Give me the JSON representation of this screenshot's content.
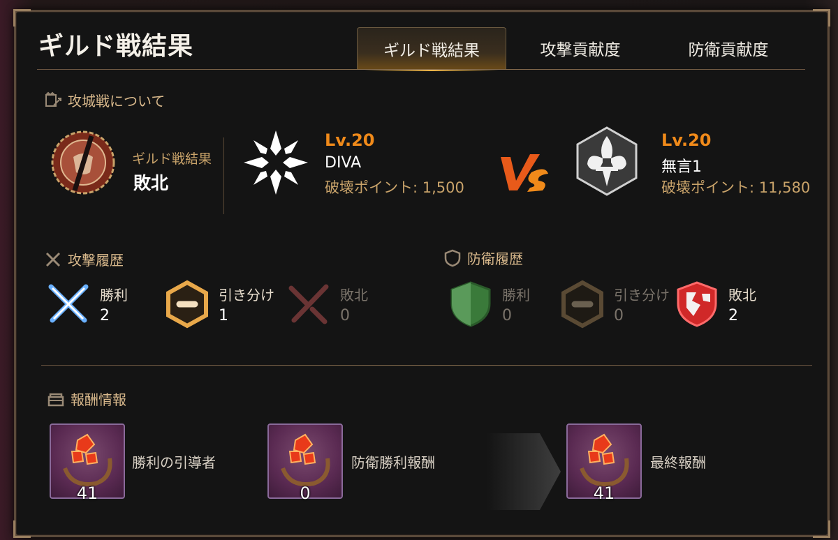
{
  "title": "ギルド戦結果",
  "tabs": [
    {
      "label": "ギルド戦結果",
      "active": true
    },
    {
      "label": "攻撃貢献度",
      "active": false
    },
    {
      "label": "防衛貢献度",
      "active": false
    }
  ],
  "siege": {
    "heading": "攻城戦について",
    "result_label": "ギルド戦結果",
    "result_value": "敗北"
  },
  "guild_left": {
    "level": "Lv.20",
    "name": "DIVA",
    "points": "破壊ポイント: 1,500"
  },
  "guild_right": {
    "level": "Lv.20",
    "name": "無言1",
    "points": "破壊ポイント: 11,580"
  },
  "attack": {
    "heading": "攻撃履歴",
    "win": {
      "label": "勝利",
      "value": "2"
    },
    "draw": {
      "label": "引き分け",
      "value": "1"
    },
    "loss": {
      "label": "敗北",
      "value": "0"
    }
  },
  "defense": {
    "heading": "防衛履歴",
    "win": {
      "label": "勝利",
      "value": "0"
    },
    "draw": {
      "label": "引き分け",
      "value": "0"
    },
    "loss": {
      "label": "敗北",
      "value": "2"
    }
  },
  "rewards": {
    "heading": "報酬情報",
    "items": [
      {
        "label": "勝利の引導者",
        "count": "41"
      },
      {
        "label": "防衛勝利報酬",
        "count": "0"
      },
      {
        "label": "最終報酬",
        "count": "41"
      }
    ]
  },
  "colors": {
    "accent": "#f08a1a",
    "gold": "#c9a36a",
    "win_blue": "#4a9cff",
    "loss_red": "#e03030",
    "green": "#3a8a3a"
  }
}
